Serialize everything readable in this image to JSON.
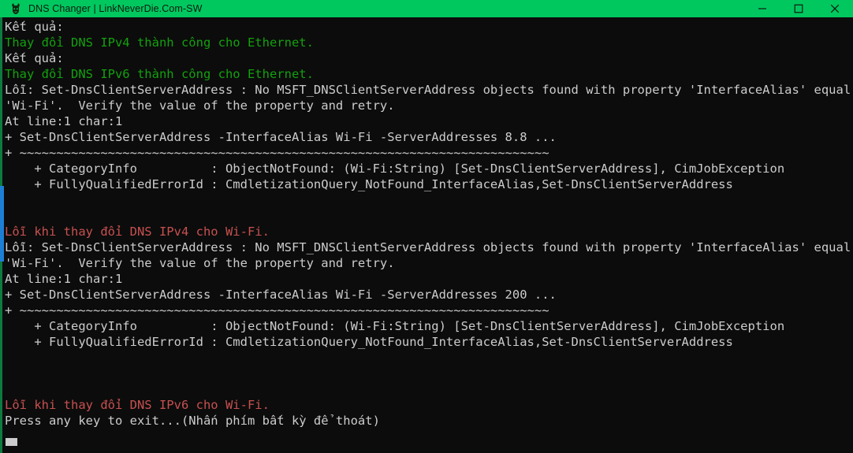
{
  "window": {
    "title": "DNS Changer | LinkNeverDie.Com-SW",
    "icon": "app-icon",
    "titlebar_color": "#00c85f",
    "titlebar_text_color": "#0a1a0f",
    "background_color": "#0c0c0c",
    "controls": {
      "minimize_label": "Minimize",
      "maximize_label": "Maximize",
      "close_label": "Close"
    }
  },
  "colors": {
    "text_white": "#cccccc",
    "text_green": "#13a10e",
    "text_red": "#c85050",
    "scrollbar_thumb": "#1d7fd4",
    "scrollbar_track": "#0d7a3f"
  },
  "console": {
    "cursor_visible": true,
    "lines": [
      {
        "text": "Kết quả:",
        "color": "white"
      },
      {
        "text": "Thay đổi DNS IPv4 thành công cho Ethernet.",
        "color": "green"
      },
      {
        "text": "Kết quả:",
        "color": "white"
      },
      {
        "text": "Thay đổi DNS IPv6 thành công cho Ethernet.",
        "color": "green"
      },
      {
        "text": "Lỗi: Set-DnsClientServerAddress : No MSFT_DNSClientServerAddress objects found with property 'InterfaceAlias' equal to",
        "color": "white"
      },
      {
        "text": "'Wi-Fi'.  Verify the value of the property and retry.",
        "color": "white"
      },
      {
        "text": "At line:1 char:1",
        "color": "white"
      },
      {
        "text": "+ Set-DnsClientServerAddress -InterfaceAlias Wi-Fi -ServerAddresses 8.8 ...",
        "color": "white"
      },
      {
        "text": "+ ~~~~~~~~~~~~~~~~~~~~~~~~~~~~~~~~~~~~~~~~~~~~~~~~~~~~~~~~~~~~~~~~~~~~~~~~",
        "color": "white"
      },
      {
        "text": "    + CategoryInfo          : ObjectNotFound: (Wi-Fi:String) [Set-DnsClientServerAddress], CimJobException",
        "color": "white"
      },
      {
        "text": "    + FullyQualifiedErrorId : CmdletizationQuery_NotFound_InterfaceAlias,Set-DnsClientServerAddress",
        "color": "white"
      },
      {
        "text": " ",
        "color": "blank"
      },
      {
        "text": " ",
        "color": "blank"
      },
      {
        "text": "Lỗi khi thay đổi DNS IPv4 cho Wi-Fi.",
        "color": "red"
      },
      {
        "text": "Lỗi: Set-DnsClientServerAddress : No MSFT_DNSClientServerAddress objects found with property 'InterfaceAlias' equal to",
        "color": "white"
      },
      {
        "text": "'Wi-Fi'.  Verify the value of the property and retry.",
        "color": "white"
      },
      {
        "text": "At line:1 char:1",
        "color": "white"
      },
      {
        "text": "+ Set-DnsClientServerAddress -InterfaceAlias Wi-Fi -ServerAddresses 200 ...",
        "color": "white"
      },
      {
        "text": "+ ~~~~~~~~~~~~~~~~~~~~~~~~~~~~~~~~~~~~~~~~~~~~~~~~~~~~~~~~~~~~~~~~~~~~~~~~",
        "color": "white"
      },
      {
        "text": "    + CategoryInfo          : ObjectNotFound: (Wi-Fi:String) [Set-DnsClientServerAddress], CimJobException",
        "color": "white"
      },
      {
        "text": "    + FullyQualifiedErrorId : CmdletizationQuery_NotFound_InterfaceAlias,Set-DnsClientServerAddress",
        "color": "white"
      },
      {
        "text": " ",
        "color": "blank"
      },
      {
        "text": " ",
        "color": "blank"
      },
      {
        "text": " ",
        "color": "blank"
      },
      {
        "text": "Lỗi khi thay đổi DNS IPv6 cho Wi-Fi.",
        "color": "red"
      },
      {
        "text": "Press any key to exit...(Nhấn phím bất kỳ để thoát)",
        "color": "white"
      }
    ]
  }
}
